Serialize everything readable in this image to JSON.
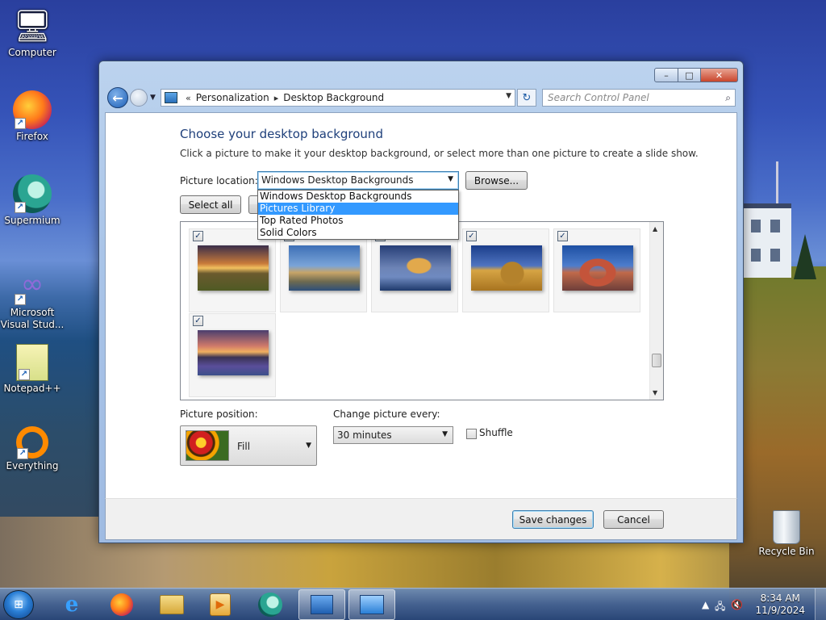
{
  "desktop": {
    "icons": [
      {
        "label": "Computer",
        "glyph": "🖥"
      },
      {
        "label": "Firefox",
        "glyph": "🦊"
      },
      {
        "label": "Supermium",
        "glyph": "◐"
      },
      {
        "label": "Microsoft Visual Stud...",
        "glyph": "∞"
      },
      {
        "label": "Notepad++",
        "glyph": "📝"
      },
      {
        "label": "Everything",
        "glyph": "○"
      },
      {
        "label": "Recycle Bin",
        "glyph": "🗑"
      }
    ]
  },
  "window": {
    "caption": {
      "minimize": "–",
      "maximize": "□",
      "close": "✕"
    },
    "nav": {
      "back": "←",
      "history": "▼",
      "crumb_prefix": "«",
      "crumbs": [
        "Personalization",
        "Desktop Background"
      ],
      "crumb_sep": "▸",
      "refresh": "↻",
      "search_placeholder": "Search Control Panel",
      "search_icon": "⌕"
    },
    "title": "Choose your desktop background",
    "description": "Click a picture to make it your desktop background, or select more than one picture to create a slide show.",
    "picture_location": {
      "label": "Picture location:",
      "value": "Windows Desktop Backgrounds",
      "options": [
        "Windows Desktop Backgrounds",
        "Pictures Library",
        "Top Rated Photos",
        "Solid Colors"
      ],
      "selected_option_index": 1
    },
    "browse_label": "Browse...",
    "select_all_label": "Select all",
    "thumbnails": [
      {
        "checked": true,
        "subject": "sunset over meadow"
      },
      {
        "checked": true,
        "subject": "lighthouse on cliff"
      },
      {
        "checked": true,
        "subject": "sea rock arch at dusk"
      },
      {
        "checked": true,
        "subject": "hay bale field"
      },
      {
        "checked": true,
        "subject": "desert arch"
      },
      {
        "checked": true,
        "subject": "lake sunset with flowers"
      }
    ],
    "picture_position": {
      "label": "Picture position:",
      "value": "Fill"
    },
    "change_picture": {
      "label": "Change picture every:",
      "value": "30 minutes"
    },
    "shuffle": {
      "label": "Shuffle",
      "checked": false
    },
    "save_label": "Save changes",
    "cancel_label": "Cancel"
  },
  "taskbar": {
    "start": "⊞",
    "clock_time": "8:34 AM",
    "clock_date": "11/9/2024"
  },
  "colors": {
    "title_blue": "#1e3f7a",
    "highlight": "#3399ff",
    "accent": "#3c7fb1"
  }
}
